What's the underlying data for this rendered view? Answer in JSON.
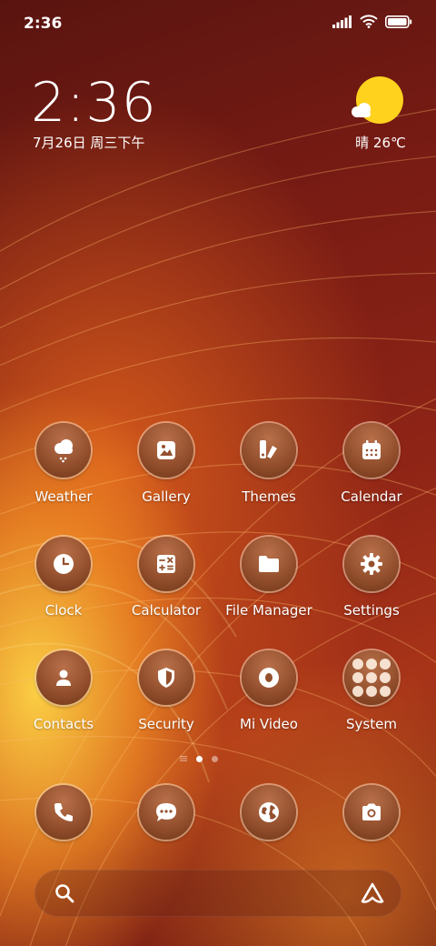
{
  "status_bar": {
    "time": "2:36"
  },
  "clock_widget": {
    "time": "2:36",
    "date": "7月26日 周三下午"
  },
  "weather_widget": {
    "condition_temp": "晴 26℃",
    "icon": "sunny-cloud-icon"
  },
  "apps": [
    {
      "label": "Weather",
      "icon": "weather-icon"
    },
    {
      "label": "Gallery",
      "icon": "gallery-icon"
    },
    {
      "label": "Themes",
      "icon": "themes-icon"
    },
    {
      "label": "Calendar",
      "icon": "calendar-icon"
    },
    {
      "label": "Clock",
      "icon": "clock-icon"
    },
    {
      "label": "Calculator",
      "icon": "calculator-icon"
    },
    {
      "label": "File Manager",
      "icon": "folder-icon"
    },
    {
      "label": "Settings",
      "icon": "gear-icon"
    },
    {
      "label": "Contacts",
      "icon": "person-icon"
    },
    {
      "label": "Security",
      "icon": "shield-icon"
    },
    {
      "label": "Mi Video",
      "icon": "video-icon"
    },
    {
      "label": "System",
      "icon": "folder-grid-icon"
    }
  ],
  "page_indicator": {
    "count": 2,
    "active": 1
  },
  "dock": [
    {
      "icon": "phone-icon"
    },
    {
      "icon": "message-icon"
    },
    {
      "icon": "browser-icon"
    },
    {
      "icon": "camera-icon"
    }
  ],
  "search_bar": {
    "left_icon": "search-icon",
    "right_icon": "assistant-icon"
  }
}
